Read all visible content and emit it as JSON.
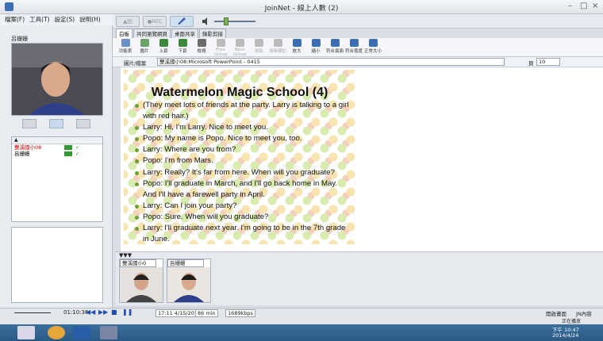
{
  "window": {
    "title": "JoinNet - 線上人數 (2)",
    "minimize": "–",
    "restore": "□",
    "close": "×"
  },
  "menu": [
    "檔案(F)",
    "工具(T)",
    "設定(S)",
    "說明(H)"
  ],
  "top_toolbar": {
    "btn1": "▲回",
    "btn2": "●REC"
  },
  "left_panel": {
    "video_label": "呂姗姗",
    "participants": [
      {
        "name": "雙溪國小08",
        "color": "#cc0000"
      },
      {
        "name": "呂姗姗",
        "color": "#000000"
      }
    ]
  },
  "tabs": [
    "白板",
    "共同瀏覽網頁",
    "桌面共享",
    "錄影剪接"
  ],
  "ribbon": [
    {
      "label": "功能表",
      "enabled": true
    },
    {
      "label": "圖片",
      "enabled": true
    },
    {
      "label": "上頁",
      "enabled": true
    },
    {
      "label": "下頁",
      "enabled": true
    },
    {
      "label": "檢視",
      "enabled": true
    },
    {
      "label": "Prev Group",
      "enabled": false
    },
    {
      "label": "Next Group",
      "enabled": false
    },
    {
      "label": "清除",
      "enabled": false
    },
    {
      "label": "清除標記",
      "enabled": false
    },
    {
      "label": "放大",
      "enabled": true
    },
    {
      "label": "縮小",
      "enabled": true
    },
    {
      "label": "符合頁面",
      "enabled": true
    },
    {
      "label": "符合寬度",
      "enabled": true
    },
    {
      "label": "正常大小",
      "enabled": true
    }
  ],
  "address": {
    "label": "圖片/檔案",
    "value": "雙溪國小08:Microsoft PowerPoint - 0415",
    "page_label": "頁",
    "page_value": "10"
  },
  "slide": {
    "title": "Watermelon Magic School (4)",
    "lines": [
      "(They meet lots of friends at the party. Larry is talking to a girl with red hair.)",
      "Larry: Hi, I'm Larry. Nice to meet you.",
      "Popo: My name is Popo. Nice to meet you, too.",
      "Larry: Where are you from?",
      "Popo: I'm from Mars.",
      "Larry: Really? It's far from here. When will you graduate?",
      "Popo: I'll graduate in March, and I'll go back home in May. And I'll have a farewell party in April.",
      "Larry: Can I join your party?",
      "Popo: Sure. When will you graduate?",
      "Larry: I'll graduate next year. I'm going to be in the 7th grade in June."
    ]
  },
  "video_panels": [
    {
      "select": "雙溪國小0"
    },
    {
      "select": "呂姗姗"
    }
  ],
  "playback": {
    "position": "01:10:36",
    "date": "17:11 4/15/2014",
    "duration": "86 min",
    "bitrate": "1689kbps"
  },
  "status_right": {
    "a": "開啟畫面",
    "b": "JN內容"
  },
  "status2": "正在播放",
  "taskbar": {
    "time": "下午 10:47",
    "date": "2014/4/24"
  }
}
